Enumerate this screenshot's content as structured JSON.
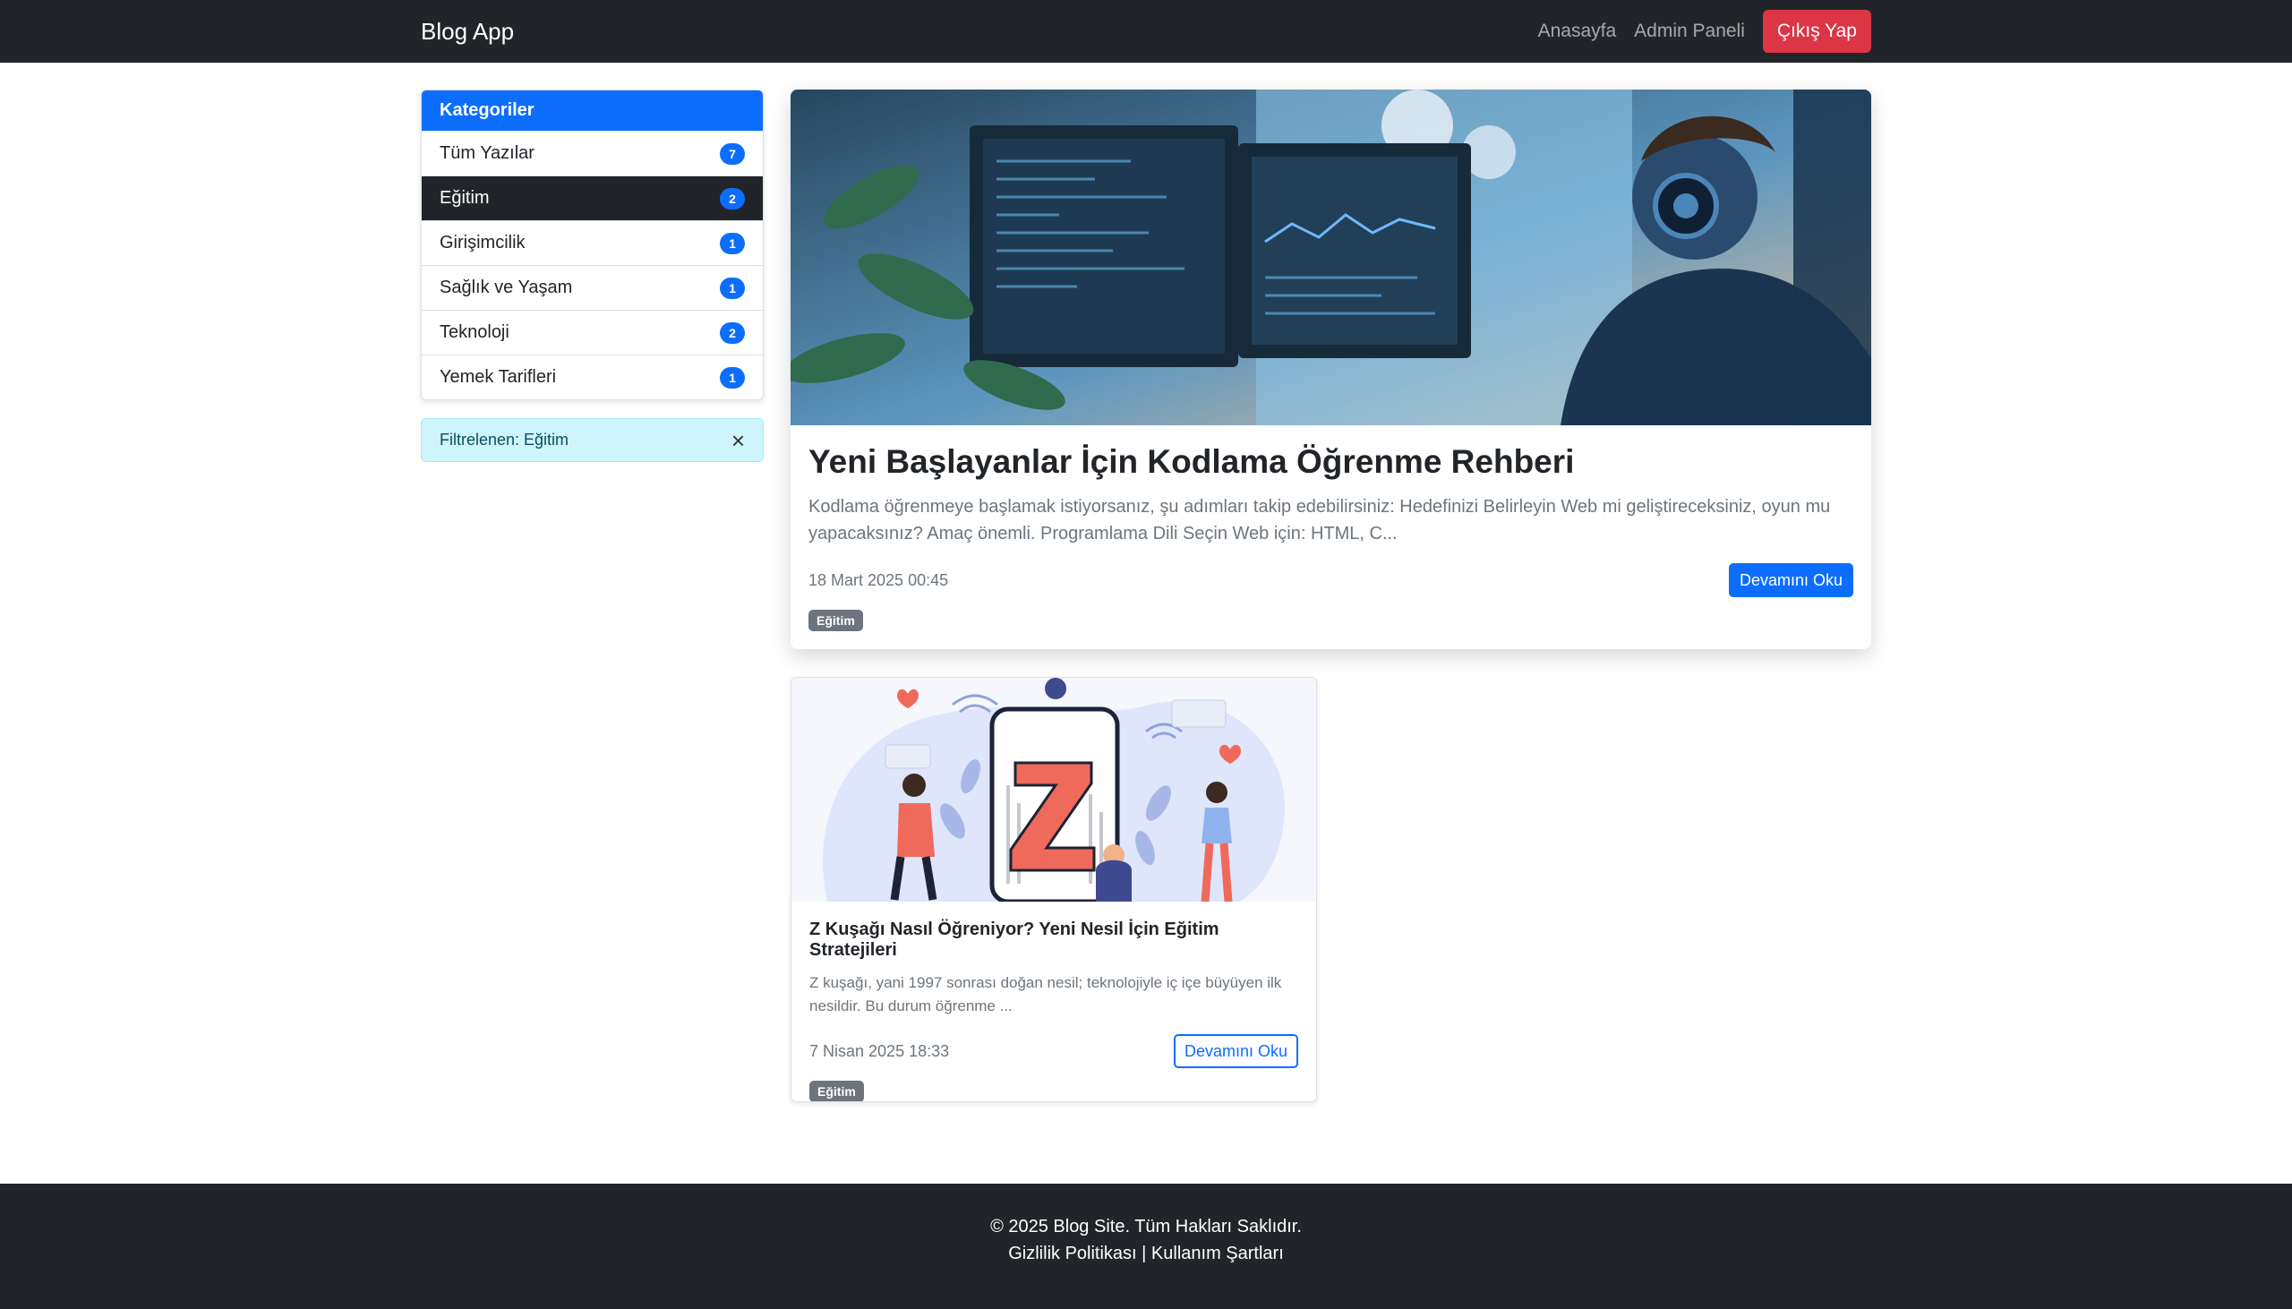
{
  "navbar": {
    "brand": "Blog App",
    "links": [
      "Anasayfa",
      "Admin Paneli"
    ],
    "logout_label": "Çıkış Yap"
  },
  "sidebar": {
    "header": "Kategoriler",
    "items": [
      {
        "label": "Tüm Yazılar",
        "count": "7",
        "active": false
      },
      {
        "label": "Eğitim",
        "count": "2",
        "active": true
      },
      {
        "label": "Girişimcilik",
        "count": "1",
        "active": false
      },
      {
        "label": "Sağlık ve Yaşam",
        "count": "1",
        "active": false
      },
      {
        "label": "Teknoloji",
        "count": "2",
        "active": false
      },
      {
        "label": "Yemek Tarifleri",
        "count": "1",
        "active": false
      }
    ],
    "filter_text": "Filtrelenen: Eğitim",
    "filter_close": "×"
  },
  "featured": {
    "title": "Yeni Başlayanlar İçin Kodlama Öğrenme Rehberi",
    "excerpt": "Kodlama öğrenmeye başlamak istiyorsanız, şu adımları takip edebilirsiniz: Hedefinizi Belirleyin Web mi geliştireceksiniz, oyun mu yapacaksınız? Amaç önemli. Programlama Dili Seçin Web için: HTML, C...",
    "date": "18 Mart 2025 00:45",
    "read_label": "Devamını Oku",
    "tag": "Eğitim"
  },
  "posts": [
    {
      "title": "Z Kuşağı Nasıl Öğreniyor? Yeni Nesil İçin Eğitim Stratejileri",
      "excerpt": "Z kuşağı, yani 1997 sonrası doğan nesil; teknolojiyle iç içe büyüyen ilk nesildir. Bu durum öğrenme ...",
      "date": "7 Nisan 2025 18:33",
      "read_label": "Devamını Oku",
      "tag": "Eğitim",
      "image_letter": "Z"
    }
  ],
  "footer": {
    "copyright": "© 2025 Blog Site. Tüm Hakları Saklıdır.",
    "privacy": "Gizlilik Politikası",
    "separator": "|",
    "terms": "Kullanım Şartları"
  },
  "colors": {
    "primary": "#0d6efd",
    "dark": "#212529",
    "danger": "#dc3545",
    "info_bg": "#cff4fc",
    "secondary": "#6c757d"
  }
}
